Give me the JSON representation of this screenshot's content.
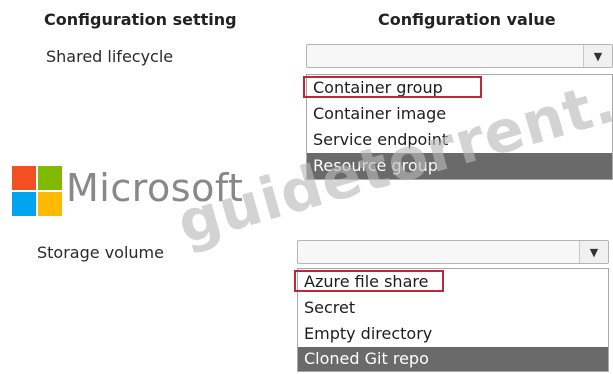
{
  "headers": {
    "setting": "Configuration setting",
    "value": "Configuration value"
  },
  "rows": [
    {
      "label": "Shared lifecycle",
      "dropdown_value": "",
      "options": [
        {
          "label": "Container group",
          "highlighted": true,
          "selected": false
        },
        {
          "label": "Container image",
          "highlighted": false,
          "selected": false
        },
        {
          "label": "Service endpoint",
          "highlighted": false,
          "selected": false
        },
        {
          "label": "Resource group",
          "highlighted": false,
          "selected": true
        }
      ]
    },
    {
      "label": "Storage volume",
      "dropdown_value": "",
      "options": [
        {
          "label": "Azure file share",
          "highlighted": true,
          "selected": false
        },
        {
          "label": "Secret",
          "highlighted": false,
          "selected": false
        },
        {
          "label": "Empty directory",
          "highlighted": false,
          "selected": false
        },
        {
          "label": "Cloned Git repo",
          "highlighted": false,
          "selected": true
        }
      ]
    }
  ],
  "dropdown_arrow_icon": "chevron-down-icon",
  "logo": {
    "text": "Microsoft",
    "colors": [
      "#f25022",
      "#7fba00",
      "#00a4ef",
      "#ffb900"
    ]
  },
  "watermark": "guidetorrent.com",
  "colors": {
    "highlight_border": "#c0263a",
    "selected_bg": "#6a6a6a"
  }
}
